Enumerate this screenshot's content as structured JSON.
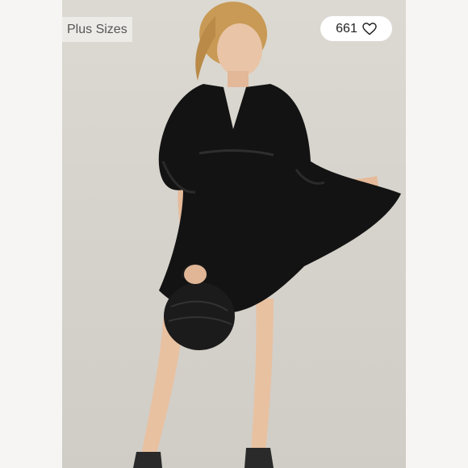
{
  "listing": {
    "badge_label": "Plus Sizes",
    "like_count": "661",
    "like_icon": "heart-outline-icon"
  },
  "colors": {
    "backdrop": "#d6d3cc",
    "dress": "#111111",
    "badge_bg": "#ecebe8",
    "like_bg": "#ffffff"
  }
}
